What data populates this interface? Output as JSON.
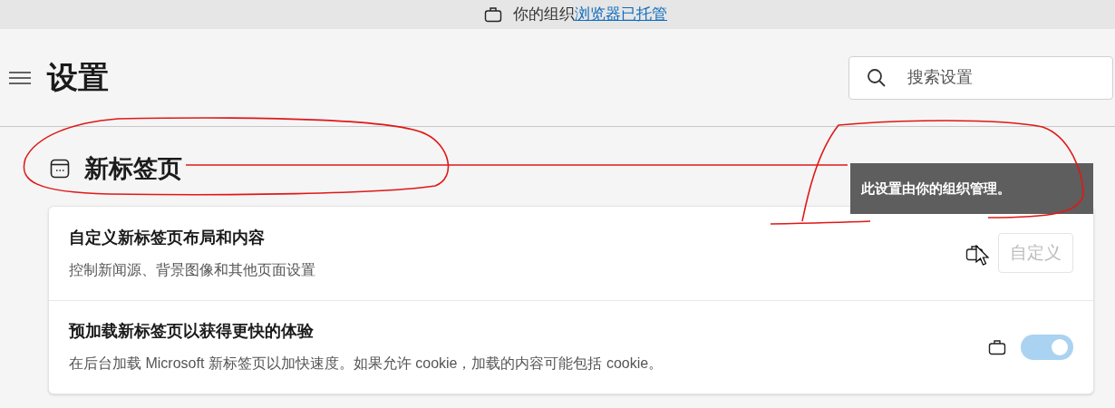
{
  "banner": {
    "text": "你的组织",
    "link": "浏览器已托管"
  },
  "header": {
    "title": "设置",
    "search": {
      "placeholder": "搜索设置"
    }
  },
  "section": {
    "title": "新标签页"
  },
  "tooltip": {
    "text": "此设置由你的组织管理。"
  },
  "rows": [
    {
      "kind": "button",
      "title": "自定义新标签页布局和内容",
      "description": "控制新闻源、背景图像和其他页面设置",
      "managed": true,
      "disabled": true,
      "button": "自定义"
    },
    {
      "kind": "toggle",
      "title": "预加载新标签页以获得更快的体验",
      "description": "在后台加载 Microsoft 新标签页以加快速度。如果允许 cookie，加载的内容可能包括 cookie。",
      "managed": true,
      "disabled": true,
      "on": true
    }
  ]
}
